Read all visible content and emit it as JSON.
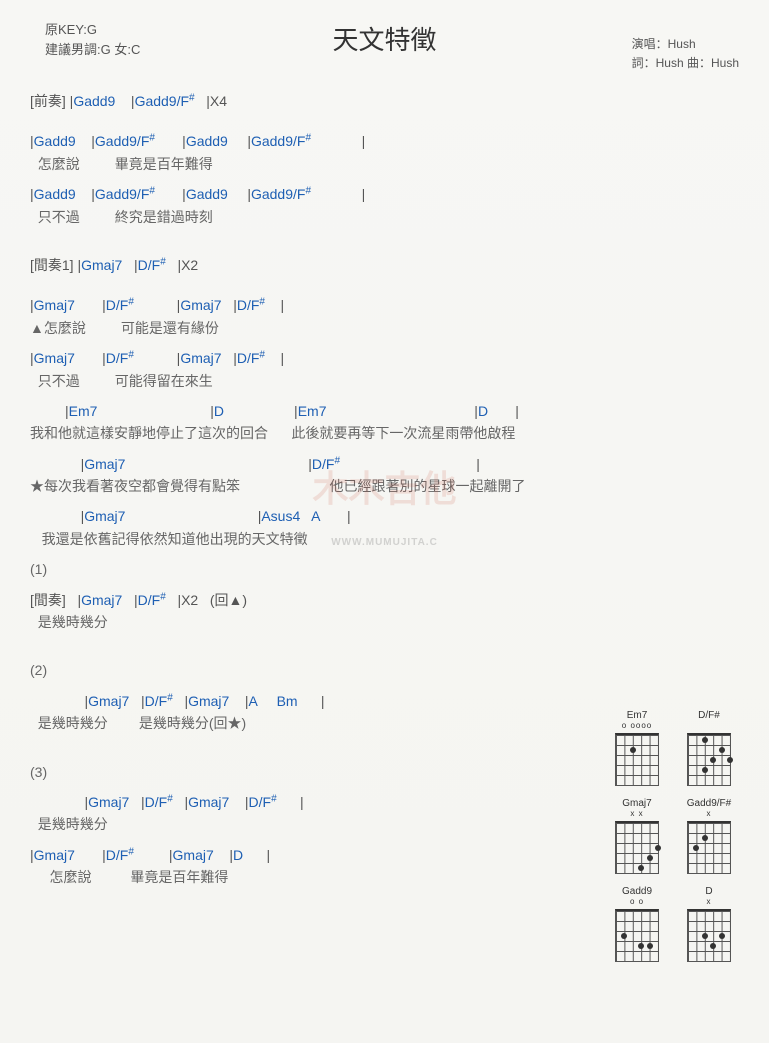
{
  "header": {
    "key_line1": "原KEY:G",
    "key_line2": "建議男調:G 女:C",
    "title": "天文特徵",
    "credit1": "演唱：Hush",
    "credit2": "詞：Hush  曲：Hush"
  },
  "watermark": {
    "main": "木木吉他",
    "sub": "WWW.MUMUJITA.C"
  },
  "lines": [
    {
      "type": "chordline",
      "segments": [
        {
          "t": "label",
          "v": "[前奏] "
        },
        {
          "t": "bar",
          "v": "|"
        },
        {
          "t": "chord",
          "v": "Gadd9"
        },
        {
          "t": "sp",
          "v": "    "
        },
        {
          "t": "bar",
          "v": "|"
        },
        {
          "t": "chord",
          "v": "Gadd9/F"
        },
        {
          "t": "sup",
          "v": "#"
        },
        {
          "t": "sp",
          "v": "   "
        },
        {
          "t": "bar",
          "v": "|"
        },
        {
          "t": "note",
          "v": "X4"
        }
      ]
    },
    {
      "type": "spacer"
    },
    {
      "type": "chordline",
      "segments": [
        {
          "t": "bar",
          "v": "|"
        },
        {
          "t": "chord",
          "v": "Gadd9"
        },
        {
          "t": "sp",
          "v": "    "
        },
        {
          "t": "bar",
          "v": "|"
        },
        {
          "t": "chord",
          "v": "Gadd9/F"
        },
        {
          "t": "sup",
          "v": "#"
        },
        {
          "t": "sp",
          "v": "       "
        },
        {
          "t": "bar",
          "v": "|"
        },
        {
          "t": "chord",
          "v": "Gadd9"
        },
        {
          "t": "sp",
          "v": "     "
        },
        {
          "t": "bar",
          "v": "|"
        },
        {
          "t": "chord",
          "v": "Gadd9/F"
        },
        {
          "t": "sup",
          "v": "#"
        },
        {
          "t": "sp",
          "v": "             "
        },
        {
          "t": "bar",
          "v": "|"
        }
      ]
    },
    {
      "type": "lyric",
      "text": "  怎麼說         畢竟是百年難得"
    },
    {
      "type": "chordline",
      "segments": [
        {
          "t": "bar",
          "v": "|"
        },
        {
          "t": "chord",
          "v": "Gadd9"
        },
        {
          "t": "sp",
          "v": "    "
        },
        {
          "t": "bar",
          "v": "|"
        },
        {
          "t": "chord",
          "v": "Gadd9/F"
        },
        {
          "t": "sup",
          "v": "#"
        },
        {
          "t": "sp",
          "v": "       "
        },
        {
          "t": "bar",
          "v": "|"
        },
        {
          "t": "chord",
          "v": "Gadd9"
        },
        {
          "t": "sp",
          "v": "     "
        },
        {
          "t": "bar",
          "v": "|"
        },
        {
          "t": "chord",
          "v": "Gadd9/F"
        },
        {
          "t": "sup",
          "v": "#"
        },
        {
          "t": "sp",
          "v": "             "
        },
        {
          "t": "bar",
          "v": "|"
        }
      ]
    },
    {
      "type": "lyric",
      "text": "  只不過         終究是錯過時刻"
    },
    {
      "type": "spacer"
    },
    {
      "type": "chordline",
      "segments": [
        {
          "t": "label",
          "v": "[間奏1] "
        },
        {
          "t": "bar",
          "v": "|"
        },
        {
          "t": "chord",
          "v": "Gmaj7"
        },
        {
          "t": "sp",
          "v": "   "
        },
        {
          "t": "bar",
          "v": "|"
        },
        {
          "t": "chord",
          "v": "D/F"
        },
        {
          "t": "sup",
          "v": "#"
        },
        {
          "t": "sp",
          "v": "   "
        },
        {
          "t": "bar",
          "v": "|"
        },
        {
          "t": "note",
          "v": "X2"
        }
      ]
    },
    {
      "type": "spacer"
    },
    {
      "type": "chordline",
      "segments": [
        {
          "t": "bar",
          "v": "|"
        },
        {
          "t": "chord",
          "v": "Gmaj7"
        },
        {
          "t": "sp",
          "v": "       "
        },
        {
          "t": "bar",
          "v": "|"
        },
        {
          "t": "chord",
          "v": "D/F"
        },
        {
          "t": "sup",
          "v": "#"
        },
        {
          "t": "sp",
          "v": "           "
        },
        {
          "t": "bar",
          "v": "|"
        },
        {
          "t": "chord",
          "v": "Gmaj7"
        },
        {
          "t": "sp",
          "v": "   "
        },
        {
          "t": "bar",
          "v": "|"
        },
        {
          "t": "chord",
          "v": "D/F"
        },
        {
          "t": "sup",
          "v": "#"
        },
        {
          "t": "sp",
          "v": "    "
        },
        {
          "t": "bar",
          "v": "|"
        }
      ]
    },
    {
      "type": "lyric",
      "text": "▲怎麼說         可能是還有緣份"
    },
    {
      "type": "chordline",
      "segments": [
        {
          "t": "bar",
          "v": "|"
        },
        {
          "t": "chord",
          "v": "Gmaj7"
        },
        {
          "t": "sp",
          "v": "       "
        },
        {
          "t": "bar",
          "v": "|"
        },
        {
          "t": "chord",
          "v": "D/F"
        },
        {
          "t": "sup",
          "v": "#"
        },
        {
          "t": "sp",
          "v": "           "
        },
        {
          "t": "bar",
          "v": "|"
        },
        {
          "t": "chord",
          "v": "Gmaj7"
        },
        {
          "t": "sp",
          "v": "   "
        },
        {
          "t": "bar",
          "v": "|"
        },
        {
          "t": "chord",
          "v": "D/F"
        },
        {
          "t": "sup",
          "v": "#"
        },
        {
          "t": "sp",
          "v": "    "
        },
        {
          "t": "bar",
          "v": "|"
        }
      ]
    },
    {
      "type": "lyric",
      "text": "  只不過         可能得留在來生"
    },
    {
      "type": "chordline",
      "segments": [
        {
          "t": "sp",
          "v": "         "
        },
        {
          "t": "bar",
          "v": "|"
        },
        {
          "t": "chord",
          "v": "Em7"
        },
        {
          "t": "sp",
          "v": "                             "
        },
        {
          "t": "bar",
          "v": "|"
        },
        {
          "t": "chord",
          "v": "D"
        },
        {
          "t": "sp",
          "v": "                  "
        },
        {
          "t": "bar",
          "v": "|"
        },
        {
          "t": "chord",
          "v": "Em7"
        },
        {
          "t": "sp",
          "v": "                                      "
        },
        {
          "t": "bar",
          "v": "|"
        },
        {
          "t": "chord",
          "v": "D"
        },
        {
          "t": "sp",
          "v": "       "
        },
        {
          "t": "bar",
          "v": "|"
        }
      ]
    },
    {
      "type": "lyric",
      "text": "我和他就這樣安靜地停止了這次的回合      此後就要再等下一次流星雨帶他啟程"
    },
    {
      "type": "chordline",
      "segments": [
        {
          "t": "sp",
          "v": "             "
        },
        {
          "t": "bar",
          "v": "|"
        },
        {
          "t": "chord",
          "v": "Gmaj7"
        },
        {
          "t": "sp",
          "v": "                                               "
        },
        {
          "t": "bar",
          "v": "|"
        },
        {
          "t": "chord",
          "v": "D/F"
        },
        {
          "t": "sup",
          "v": "#"
        },
        {
          "t": "sp",
          "v": "                                   "
        },
        {
          "t": "bar",
          "v": "|"
        }
      ]
    },
    {
      "type": "lyric",
      "text": "★每次我看著夜空都會覺得有點笨                       他已經跟著別的星球一起離開了"
    },
    {
      "type": "chordline",
      "segments": [
        {
          "t": "sp",
          "v": "             "
        },
        {
          "t": "bar",
          "v": "|"
        },
        {
          "t": "chord",
          "v": "Gmaj7"
        },
        {
          "t": "sp",
          "v": "                                  "
        },
        {
          "t": "bar",
          "v": "|"
        },
        {
          "t": "chord",
          "v": "Asus4"
        },
        {
          "t": "sp",
          "v": "   "
        },
        {
          "t": "chord",
          "v": "A"
        },
        {
          "t": "sp",
          "v": "       "
        },
        {
          "t": "bar",
          "v": "|"
        }
      ]
    },
    {
      "type": "lyric",
      "text": "   我還是依舊記得依然知道他出現的天文特徵"
    },
    {
      "type": "lyric",
      "text": "(1)"
    },
    {
      "type": "chordline",
      "segments": [
        {
          "t": "label",
          "v": "[間奏]   "
        },
        {
          "t": "bar",
          "v": "|"
        },
        {
          "t": "chord",
          "v": "Gmaj7"
        },
        {
          "t": "sp",
          "v": "   "
        },
        {
          "t": "bar",
          "v": "|"
        },
        {
          "t": "chord",
          "v": "D/F"
        },
        {
          "t": "sup",
          "v": "#"
        },
        {
          "t": "sp",
          "v": "   "
        },
        {
          "t": "bar",
          "v": "|"
        },
        {
          "t": "note",
          "v": "X2   (回▲)"
        }
      ]
    },
    {
      "type": "lyric",
      "text": "  是幾時幾分"
    },
    {
      "type": "spacer"
    },
    {
      "type": "lyric",
      "text": "(2)"
    },
    {
      "type": "chordline",
      "segments": [
        {
          "t": "sp",
          "v": "              "
        },
        {
          "t": "bar",
          "v": "|"
        },
        {
          "t": "chord",
          "v": "Gmaj7"
        },
        {
          "t": "sp",
          "v": "   "
        },
        {
          "t": "bar",
          "v": "|"
        },
        {
          "t": "chord",
          "v": "D/F"
        },
        {
          "t": "sup",
          "v": "#"
        },
        {
          "t": "sp",
          "v": "   "
        },
        {
          "t": "bar",
          "v": "|"
        },
        {
          "t": "chord",
          "v": "Gmaj7"
        },
        {
          "t": "sp",
          "v": "    "
        },
        {
          "t": "bar",
          "v": "|"
        },
        {
          "t": "chord",
          "v": "A"
        },
        {
          "t": "sp",
          "v": "     "
        },
        {
          "t": "chord",
          "v": "Bm"
        },
        {
          "t": "sp",
          "v": "      "
        },
        {
          "t": "bar",
          "v": "|"
        }
      ]
    },
    {
      "type": "lyric",
      "text": "  是幾時幾分        是幾時幾分(回★)"
    },
    {
      "type": "spacer"
    },
    {
      "type": "lyric",
      "text": "(3)"
    },
    {
      "type": "chordline",
      "segments": [
        {
          "t": "sp",
          "v": "              "
        },
        {
          "t": "bar",
          "v": "|"
        },
        {
          "t": "chord",
          "v": "Gmaj7"
        },
        {
          "t": "sp",
          "v": "   "
        },
        {
          "t": "bar",
          "v": "|"
        },
        {
          "t": "chord",
          "v": "D/F"
        },
        {
          "t": "sup",
          "v": "#"
        },
        {
          "t": "sp",
          "v": "   "
        },
        {
          "t": "bar",
          "v": "|"
        },
        {
          "t": "chord",
          "v": "Gmaj7"
        },
        {
          "t": "sp",
          "v": "    "
        },
        {
          "t": "bar",
          "v": "|"
        },
        {
          "t": "chord",
          "v": "D/F"
        },
        {
          "t": "sup",
          "v": "#"
        },
        {
          "t": "sp",
          "v": "      "
        },
        {
          "t": "bar",
          "v": "|"
        }
      ]
    },
    {
      "type": "lyric",
      "text": "  是幾時幾分"
    },
    {
      "type": "chordline",
      "segments": [
        {
          "t": "bar",
          "v": "|"
        },
        {
          "t": "chord",
          "v": "Gmaj7"
        },
        {
          "t": "sp",
          "v": "       "
        },
        {
          "t": "bar",
          "v": "|"
        },
        {
          "t": "chord",
          "v": "D/F"
        },
        {
          "t": "sup",
          "v": "#"
        },
        {
          "t": "sp",
          "v": "         "
        },
        {
          "t": "bar",
          "v": "|"
        },
        {
          "t": "chord",
          "v": "Gmaj7"
        },
        {
          "t": "sp",
          "v": "    "
        },
        {
          "t": "bar",
          "v": "|"
        },
        {
          "t": "chord",
          "v": "D"
        },
        {
          "t": "sp",
          "v": "      "
        },
        {
          "t": "bar",
          "v": "|"
        }
      ]
    },
    {
      "type": "lyric",
      "text": "     怎麼說          畢竟是百年難得"
    }
  ],
  "diagrams": [
    {
      "name": "Em7",
      "marks": "o oooo",
      "dots": [
        [
          1,
          2
        ]
      ]
    },
    {
      "name": "D/F#",
      "marks": "      ",
      "dots": [
        [
          0,
          2
        ],
        [
          1,
          4
        ],
        [
          2,
          3
        ],
        [
          2,
          5
        ],
        [
          3,
          2
        ]
      ]
    },
    {
      "name": "Gmaj7",
      "marks": "x x   ",
      "dots": [
        [
          2,
          5
        ],
        [
          3,
          4
        ],
        [
          4,
          3
        ]
      ]
    },
    {
      "name": "Gadd9/F#",
      "marks": "     x",
      "dots": [
        [
          1,
          2
        ],
        [
          2,
          1
        ]
      ]
    },
    {
      "name": "Gadd9",
      "marks": "o o   ",
      "dots": [
        [
          2,
          1
        ],
        [
          3,
          3
        ],
        [
          3,
          4
        ]
      ]
    },
    {
      "name": "D",
      "marks": "   x  ",
      "dots": [
        [
          2,
          2
        ],
        [
          2,
          4
        ],
        [
          3,
          3
        ]
      ]
    }
  ]
}
